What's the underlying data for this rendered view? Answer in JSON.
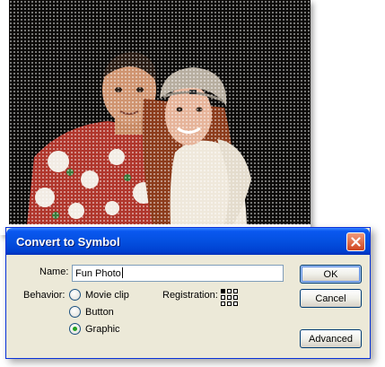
{
  "photo": {
    "description_icon": "photo-couple"
  },
  "dialog": {
    "title": "Convert to Symbol",
    "name_label": "Name:",
    "name_value": "Fun Photo",
    "behavior_label": "Behavior:",
    "behavior_options": [
      {
        "label": "Movie clip",
        "selected": false
      },
      {
        "label": "Button",
        "selected": false
      },
      {
        "label": "Graphic",
        "selected": true
      }
    ],
    "registration_label": "Registration:",
    "buttons": {
      "ok": "OK",
      "cancel": "Cancel",
      "advanced": "Advanced"
    }
  },
  "colors": {
    "titlebar": "#0450e0",
    "dialog_bg": "#ece9d8",
    "close_button": "#d0451f"
  }
}
